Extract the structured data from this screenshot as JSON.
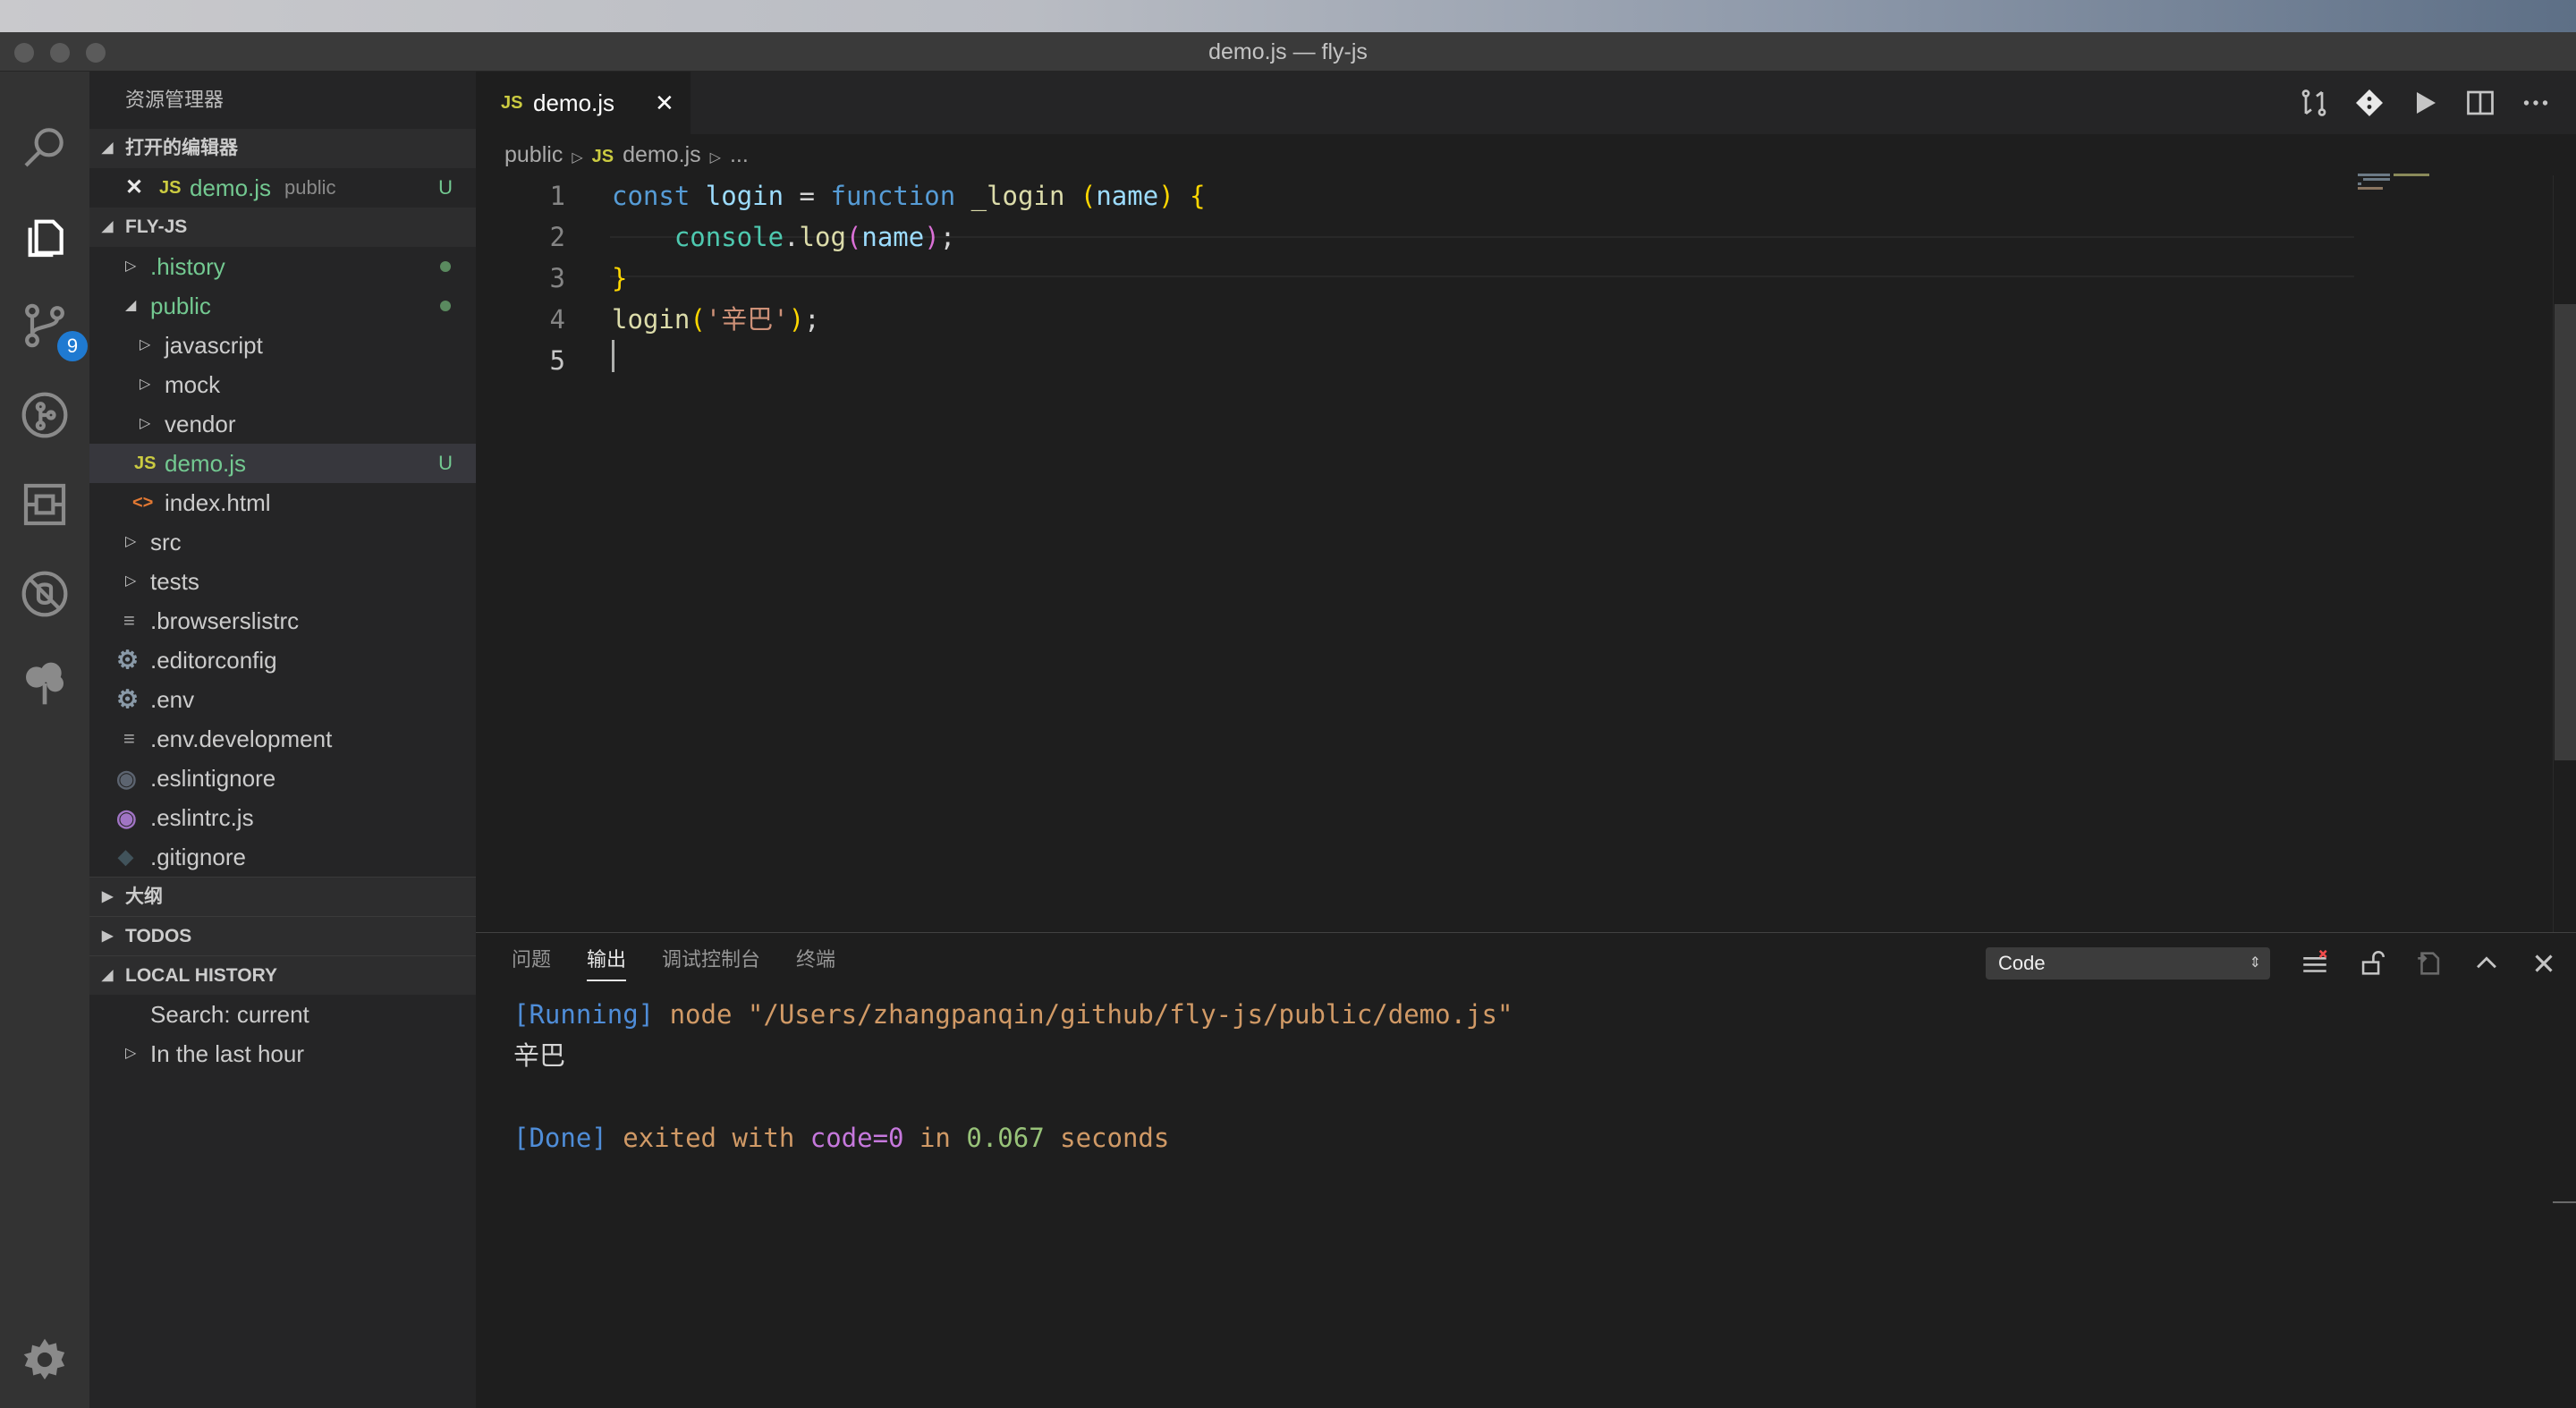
{
  "window": {
    "title": "demo.js — fly-js"
  },
  "activity_bar": {
    "scm_badge": "9"
  },
  "sidebar": {
    "title": "资源管理器",
    "open_editors": {
      "header": "打开的编辑器",
      "items": [
        {
          "icon": "JS",
          "name": "demo.js",
          "folder": "public",
          "status": "U"
        }
      ]
    },
    "project": {
      "header": "FLY-JS",
      "items": [
        {
          "name": ".history"
        },
        {
          "name": "public"
        },
        {
          "name": "javascript"
        },
        {
          "name": "mock"
        },
        {
          "name": "vendor"
        },
        {
          "icon": "JS",
          "name": "demo.js",
          "status": "U"
        },
        {
          "icon": "<>",
          "name": "index.html"
        },
        {
          "name": "src"
        },
        {
          "name": "tests"
        },
        {
          "name": ".browserslistrc"
        },
        {
          "name": ".editorconfig"
        },
        {
          "name": ".env"
        },
        {
          "name": ".env.development"
        },
        {
          "name": ".eslintignore"
        },
        {
          "name": ".eslintrc.js"
        },
        {
          "name": ".gitignore"
        }
      ]
    },
    "outline": {
      "header": "大纲"
    },
    "todos": {
      "header": "TODOS"
    },
    "local_history": {
      "header": "LOCAL HISTORY",
      "search": "Search: current",
      "group": "In the last hour"
    }
  },
  "editor": {
    "tab": {
      "icon": "JS",
      "name": "demo.js",
      "close": "✕"
    },
    "breadcrumb": {
      "folder": "public",
      "file_icon": "JS",
      "file": "demo.js",
      "more": "..."
    },
    "lines": [
      {
        "n": "1",
        "tokens": [
          {
            "t": "const",
            "c": "k"
          },
          {
            "t": " "
          },
          {
            "t": "login",
            "c": "p"
          },
          {
            "t": " = "
          },
          {
            "t": "function",
            "c": "k"
          },
          {
            "t": " "
          },
          {
            "t": "_login",
            "c": "f"
          },
          {
            "t": " "
          },
          {
            "t": "(",
            "c": "b1"
          },
          {
            "t": "name",
            "c": "p"
          },
          {
            "t": ")",
            "c": "b1"
          },
          {
            "t": " "
          },
          {
            "t": "{",
            "c": "b1"
          }
        ]
      },
      {
        "n": "2",
        "tokens": [
          {
            "t": "    "
          },
          {
            "t": "console",
            "c": "t"
          },
          {
            "t": "."
          },
          {
            "t": "log",
            "c": "f"
          },
          {
            "t": "(",
            "c": "b2"
          },
          {
            "t": "name",
            "c": "p"
          },
          {
            "t": ")",
            "c": "b2"
          },
          {
            "t": ";"
          }
        ]
      },
      {
        "n": "3",
        "tokens": [
          {
            "t": "}",
            "c": "b1"
          }
        ]
      },
      {
        "n": "4",
        "tokens": [
          {
            "t": "login",
            "c": "f"
          },
          {
            "t": "(",
            "c": "b1"
          },
          {
            "t": "'辛巴'",
            "c": "s"
          },
          {
            "t": ")",
            "c": "b1"
          },
          {
            "t": ";"
          }
        ]
      },
      {
        "n": "5",
        "tokens": []
      }
    ]
  },
  "panel": {
    "tabs": [
      "问题",
      "输出",
      "调试控制台",
      "终端"
    ],
    "active_tab": "输出",
    "channel": "Code",
    "output": {
      "line1_tag": "[Running]",
      "line1_cmd": " node \"/Users/zhangpanqin/github/fly-js/public/demo.js\"",
      "line2": "辛巴",
      "line4_tag": "[Done]",
      "line4_a": " exited with ",
      "line4_code": "code=0",
      "line4_b": " in ",
      "line4_time": "0.067",
      "line4_c": " seconds"
    }
  }
}
